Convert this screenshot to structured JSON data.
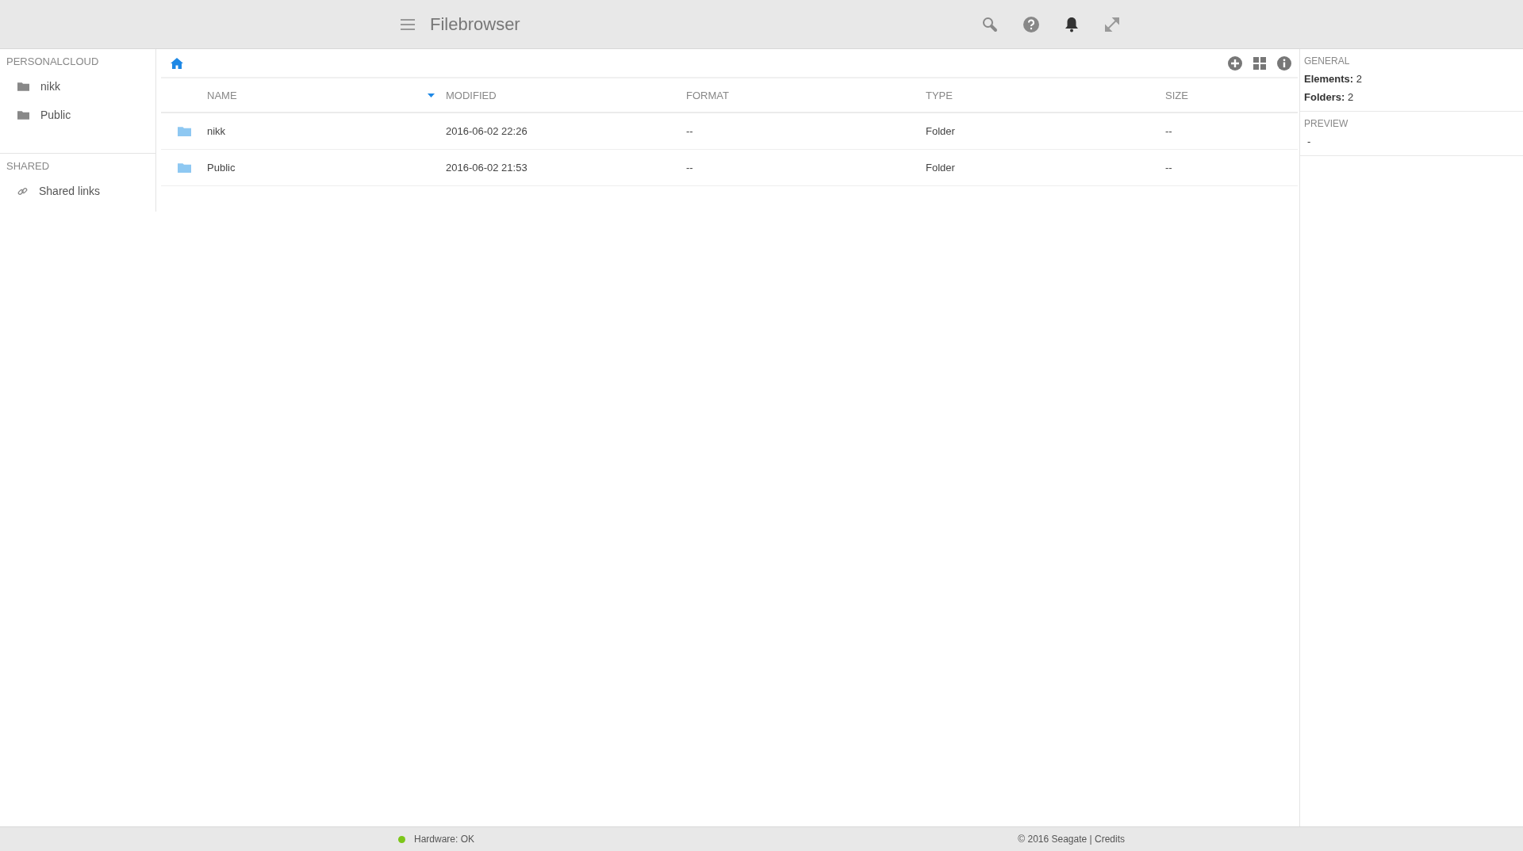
{
  "header": {
    "title": "Filebrowser"
  },
  "sidebar": {
    "sections": [
      {
        "title": "PERSONALCLOUD",
        "items": [
          {
            "label": "nikk",
            "kind": "folder"
          },
          {
            "label": "Public",
            "kind": "folder"
          }
        ]
      },
      {
        "title": "SHARED",
        "items": [
          {
            "label": "Shared links",
            "kind": "link"
          }
        ]
      }
    ]
  },
  "table": {
    "columns": [
      {
        "label": "NAME",
        "sorted": true
      },
      {
        "label": "MODIFIED",
        "sorted": false
      },
      {
        "label": "FORMAT",
        "sorted": false
      },
      {
        "label": "TYPE",
        "sorted": false
      },
      {
        "label": "SIZE",
        "sorted": false
      }
    ],
    "rows": [
      {
        "name": "nikk",
        "modified": "2016-06-02 22:26",
        "format": "--",
        "type": "Folder",
        "size": "--"
      },
      {
        "name": "Public",
        "modified": "2016-06-02 21:53",
        "format": "--",
        "type": "Folder",
        "size": "--"
      }
    ]
  },
  "details": {
    "general_title": "GENERAL",
    "stats": [
      {
        "label": "Elements:",
        "value": "2"
      },
      {
        "label": "Folders:",
        "value": "2"
      }
    ],
    "preview_title": "PREVIEW",
    "preview": "-"
  },
  "footer": {
    "status": {
      "text": "Hardware: OK",
      "color": "#7cc619"
    },
    "copyright": "© 2016 Seagate | Credits"
  }
}
